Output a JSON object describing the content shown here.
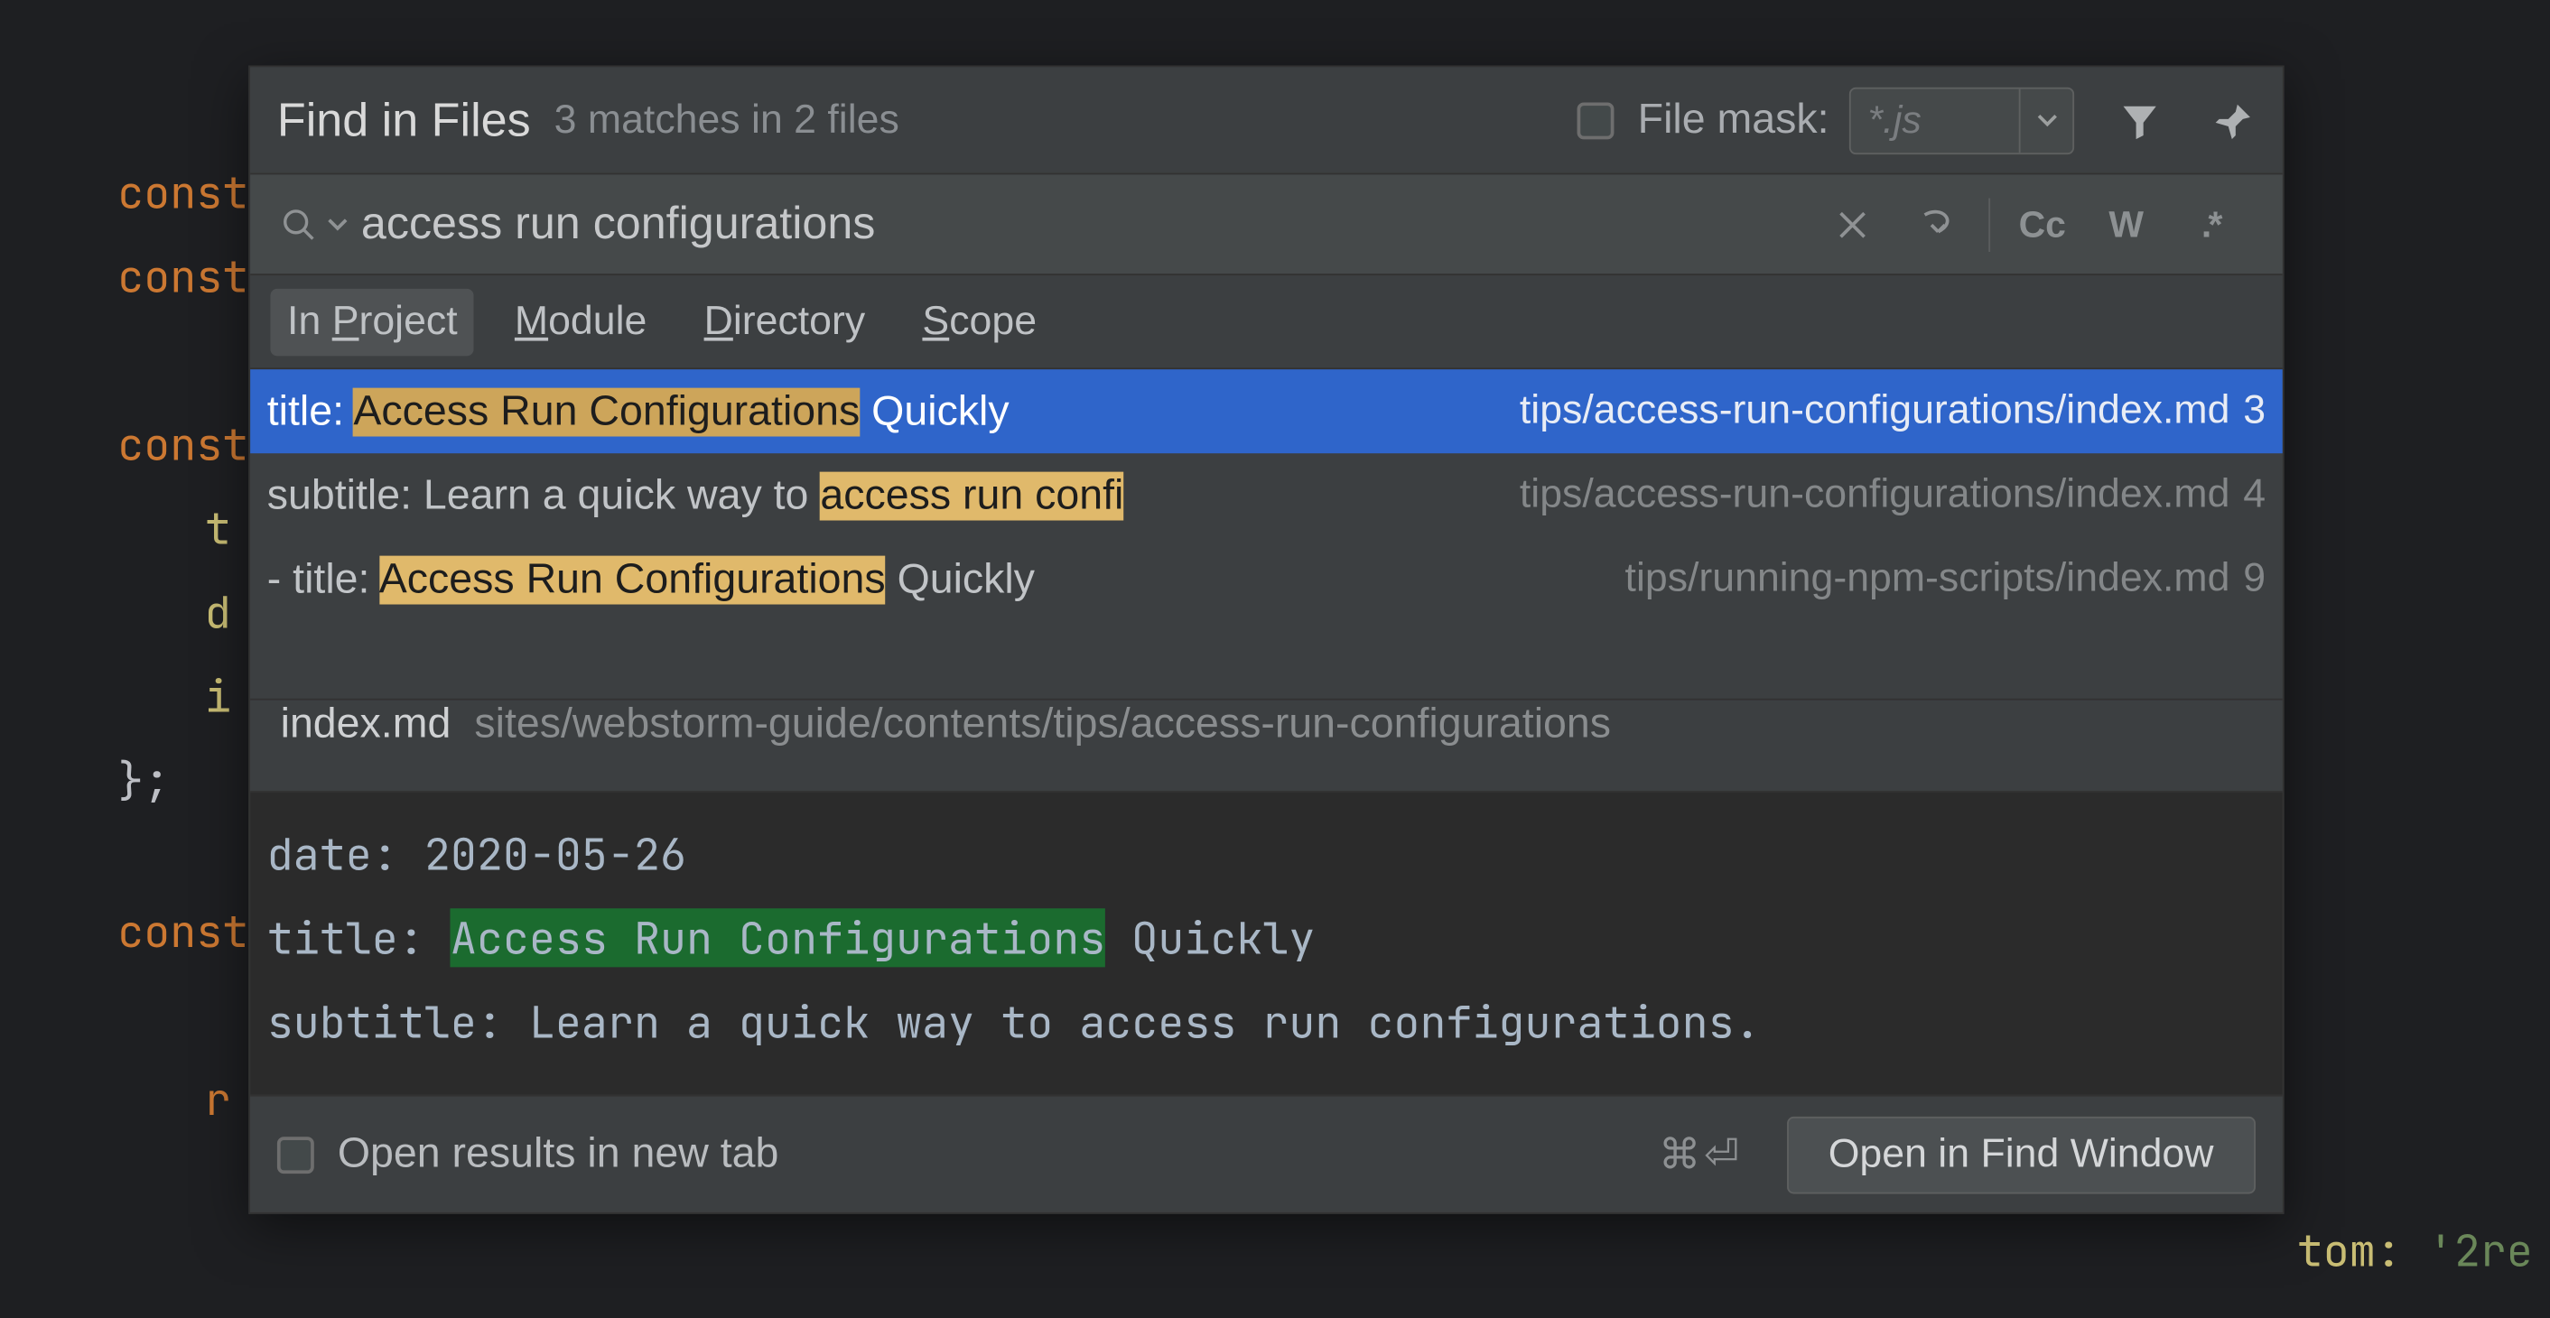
{
  "editor_bg": {
    "l1": "const",
    "l2": "const",
    "l3": "const",
    "l4": "t",
    "l5": "d",
    "l6": "i",
    "l7": "};",
    "l8": "const",
    "l9": "r",
    "l10_tom": "tom:",
    "l10_str": "'2re"
  },
  "dialog": {
    "title": "Find in Files",
    "status": "3 matches in 2 files",
    "filemask_label": "File mask:",
    "filemask_placeholder": "*.js"
  },
  "search": {
    "value": "access run configurations",
    "cc": "Cc",
    "w": "W",
    "regex": ".*"
  },
  "tabs": {
    "in_project_pre": "In ",
    "in_project_u": "P",
    "in_project_post": "roject",
    "module_u": "M",
    "module_post": "odule",
    "directory_u": "D",
    "directory_post": "irectory",
    "scope_u": "S",
    "scope_post": "cope"
  },
  "results": [
    {
      "pre": "title: ",
      "hl": "Access Run Configurations",
      "post": " Quickly",
      "path": "tips/access-run-configurations/index.md",
      "line": "3",
      "selected": true
    },
    {
      "pre": "subtitle: Learn a quick way to ",
      "hl": "access run confi",
      "post": "",
      "path": "tips/access-run-configurations/index.md",
      "line": "4",
      "selected": false
    },
    {
      "pre": "  - title: ",
      "hl": "Access Run Configurations",
      "post": " Quickly",
      "path": "tips/running-npm-scripts/index.md",
      "line": "9",
      "selected": false
    }
  ],
  "preview": {
    "file": "index.md",
    "path": "sites/webstorm-guide/contents/tips/access-run-configurations",
    "l1": "date: 2020-05-26",
    "l2_pre": "title: ",
    "l2_hl": "Access Run Configurations",
    "l2_post": " Quickly",
    "l3": "subtitle: Learn a quick way to access run configurations."
  },
  "footer": {
    "open_tab": "Open results in new tab",
    "shortcut": "⌘⏎",
    "open_window": "Open in Find Window"
  }
}
